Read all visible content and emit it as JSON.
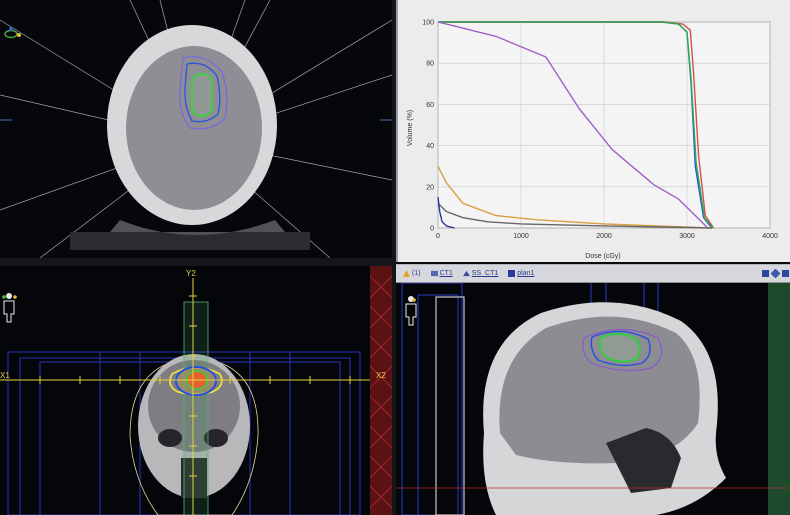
{
  "axial": {},
  "coronal": {
    "y_label": "Y2",
    "x_left": "X1",
    "x_right": "X2"
  },
  "tabs": [
    {
      "label": "(1)",
      "icon": "warning-icon"
    },
    {
      "label": "CT1",
      "icon": "ct-icon"
    },
    {
      "label": "SS_CT1",
      "icon": "structure-set-icon"
    },
    {
      "label": "plan1",
      "icon": "plan-icon"
    }
  ],
  "chart_data": {
    "type": "line",
    "title": "",
    "xlabel": "Dose (cGy)",
    "ylabel": "Volume (%)",
    "xlim": [
      0,
      4000
    ],
    "ylim": [
      0,
      100
    ],
    "x_ticks": [
      "0",
      "1000",
      "2000",
      "3000",
      "4000"
    ],
    "y_ticks": [
      "0",
      "20",
      "40",
      "60",
      "80",
      "100"
    ],
    "grid": true,
    "series": [
      {
        "color": "#2255dd",
        "x": [
          0,
          2700,
          2900,
          3000,
          3050,
          3100,
          3200,
          3300
        ],
        "y": [
          100,
          100,
          99,
          95,
          70,
          30,
          5,
          0
        ]
      },
      {
        "color": "#d45050",
        "x": [
          0,
          2750,
          2950,
          3040,
          3080,
          3140,
          3220,
          3320
        ],
        "y": [
          100,
          100,
          99,
          96,
          75,
          35,
          6,
          0
        ]
      },
      {
        "color": "#2fa84f",
        "x": [
          0,
          2700,
          2900,
          3000,
          3050,
          3110,
          3210,
          3310
        ],
        "y": [
          100,
          100,
          99,
          95,
          72,
          32,
          5,
          0
        ]
      },
      {
        "color": "#a060c8",
        "x": [
          0,
          200,
          700,
          1300,
          1700,
          2100,
          2600,
          2900,
          3100,
          3250
        ],
        "y": [
          100,
          98,
          93,
          83,
          58,
          38,
          21,
          14,
          6,
          0
        ]
      },
      {
        "color": "#d9a040",
        "x": [
          0,
          100,
          300,
          700,
          1200,
          2000,
          3300
        ],
        "y": [
          30,
          22,
          12,
          6,
          4,
          2,
          0
        ]
      },
      {
        "color": "#666666",
        "x": [
          0,
          100,
          300,
          600,
          1000,
          2000,
          3300
        ],
        "y": [
          12,
          8,
          5,
          3,
          2,
          1,
          0
        ]
      },
      {
        "color": "#2a3a9a",
        "x": [
          0,
          20,
          50,
          100,
          200
        ],
        "y": [
          15,
          8,
          3,
          1,
          0
        ]
      }
    ]
  }
}
